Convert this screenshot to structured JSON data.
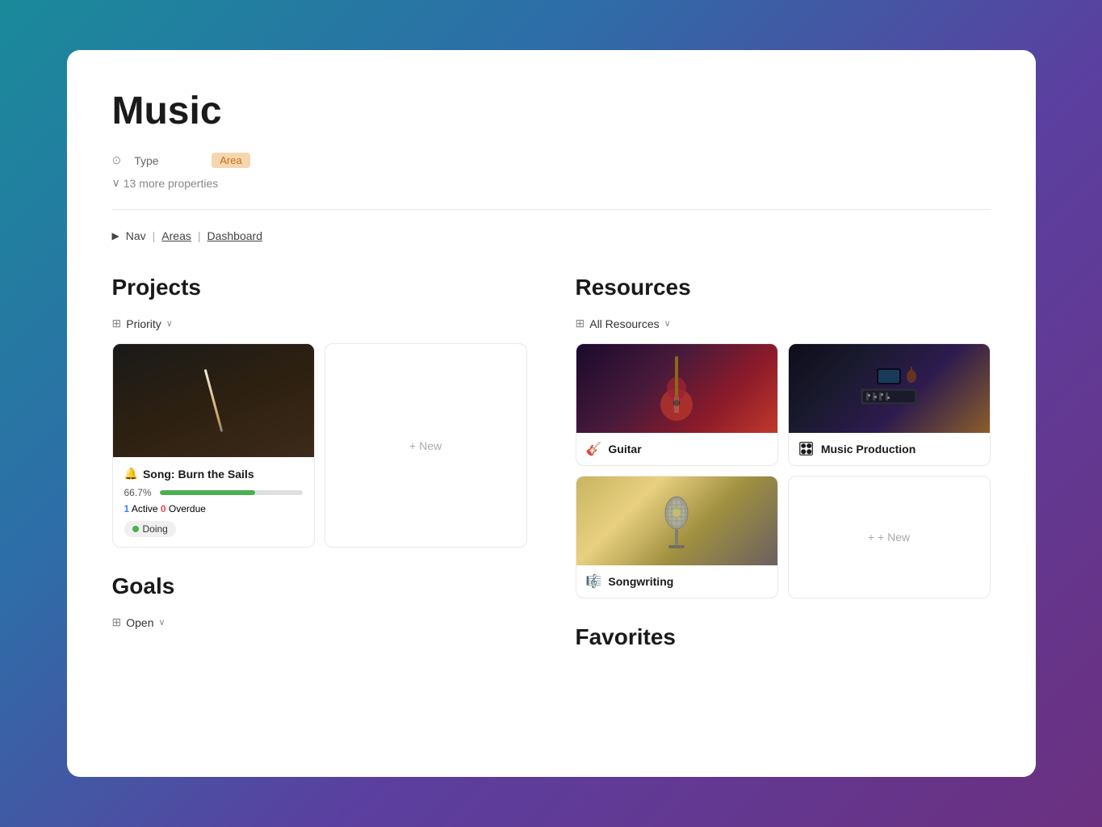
{
  "page": {
    "title": "Music",
    "property_type_label": "Type",
    "property_type_icon": "⊙",
    "property_type_value": "Area",
    "more_properties_label": "13 more properties",
    "nav": {
      "arrow": "▶",
      "nav_label": "Nav",
      "separator1": "|",
      "areas_label": "Areas",
      "separator2": "|",
      "dashboard_label": "Dashboard"
    }
  },
  "projects": {
    "section_title": "Projects",
    "filter_icon": "⊞",
    "filter_label": "Priority",
    "filter_chevron": "∨",
    "cards": [
      {
        "title": "Song: Burn the Sails",
        "icon": "🔔",
        "progress_percent": "66.7%",
        "progress_value": 66.7,
        "active_count": "1",
        "active_label": "Active",
        "overdue_count": "0",
        "overdue_label": "Overdue",
        "status": "Doing"
      }
    ],
    "new_card_label": "+ New"
  },
  "resources": {
    "section_title": "Resources",
    "filter_icon": "⊞",
    "filter_label": "All Resources",
    "filter_chevron": "∨",
    "cards": [
      {
        "title": "Guitar",
        "icon": "🎸",
        "image_type": "guitar"
      },
      {
        "title": "Music Production",
        "icon": "🎛",
        "image_type": "studio"
      },
      {
        "title": "Songwriting",
        "icon": "🎼",
        "image_type": "mic"
      }
    ],
    "new_card_label": "+ New"
  },
  "goals": {
    "section_title": "Goals",
    "filter_icon": "⊞",
    "filter_label": "Open",
    "filter_chevron": "∨"
  },
  "favorites": {
    "section_title": "Favorites"
  }
}
